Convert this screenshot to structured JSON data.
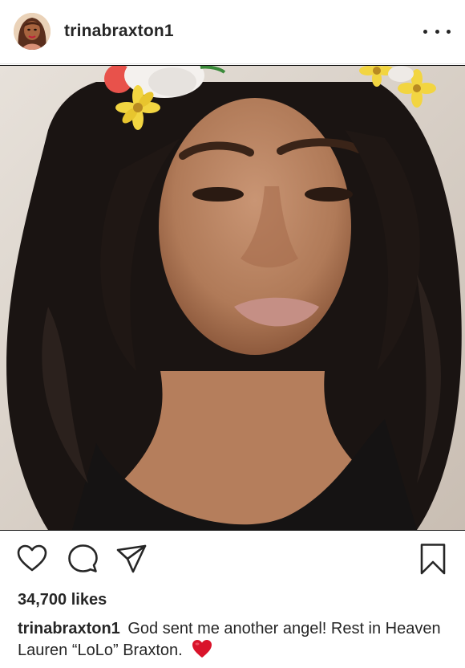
{
  "header": {
    "username": "trinabraxton1",
    "more_icon": "more-horizontal-icon"
  },
  "photo": {
    "filter": "flower-crown-filter"
  },
  "actions": {
    "icons": [
      "heart-icon",
      "comment-icon",
      "share-icon",
      "bookmark-icon"
    ]
  },
  "likes": {
    "text": "34,700 likes"
  },
  "caption": {
    "username": "trinabraxton1",
    "text": "God sent me another angel! Rest in Heaven Lauren “LoLo” Braxton.",
    "emoji": "red-heart-emoji"
  },
  "colors": {
    "text": "#262626",
    "heart_emoji": "#d9132a",
    "divider": "#e6e6e6"
  }
}
